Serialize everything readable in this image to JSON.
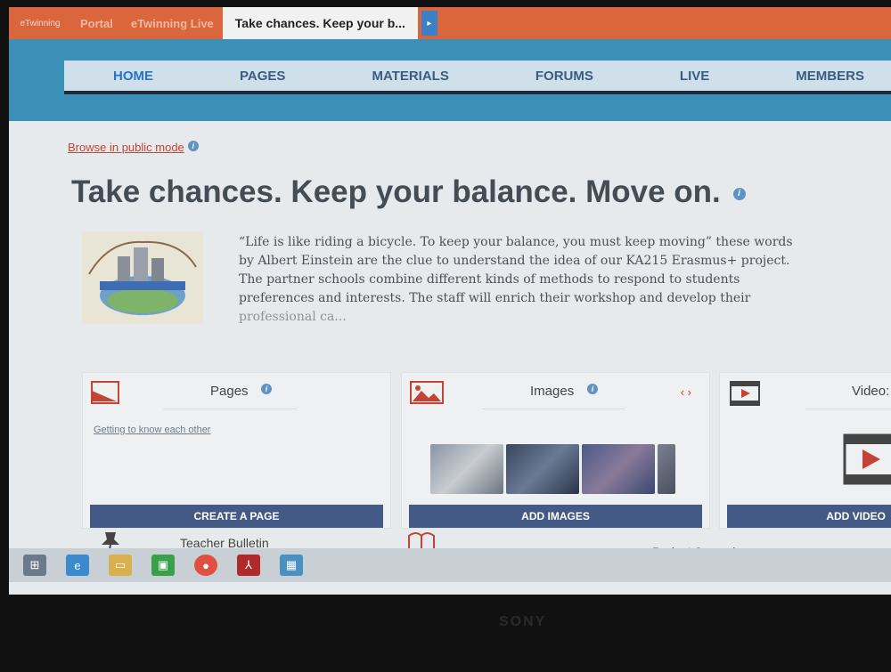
{
  "tabbar": {
    "logo": "eTwinning",
    "tabs": [
      {
        "label": "Portal"
      },
      {
        "label": "eTwinning Live"
      },
      {
        "label": "Take chances. Keep your b..."
      }
    ]
  },
  "nav": {
    "items": [
      "HOME",
      "PAGES",
      "MATERIALS",
      "FORUMS",
      "LIVE",
      "MEMBERS"
    ]
  },
  "browse_link": "Browse in public mode",
  "title": "Take chances. Keep your balance. Move on.",
  "description": {
    "text": "“Life is like riding a bicycle. To keep your balance, you must keep moving” these words by Albert Einstein are the clue to understand the idea of our KA215 Erasmus+ project. The partner schools combine different kinds of methods to respond to students preferences and interests. The staff will enrich their workshop and develop their",
    "faded": "professional ca..."
  },
  "panels": {
    "pages": {
      "title": "Pages",
      "link": "Getting to know each other",
      "button": "CREATE A PAGE"
    },
    "images": {
      "title": "Images",
      "arrows": "‹ ›",
      "button": "ADD IMAGES"
    },
    "videos": {
      "title": "Video:",
      "button": "ADD VIDEO"
    }
  },
  "bottom": {
    "teacher_bulletin": "Teacher Bulletin",
    "project_journal": "Project Journal"
  },
  "bezel_brand": "SONY",
  "colors": {
    "tabbar": "#d9663c",
    "nav_bg": "#3a90b6",
    "button": "#435a86",
    "link": "#c54334"
  }
}
